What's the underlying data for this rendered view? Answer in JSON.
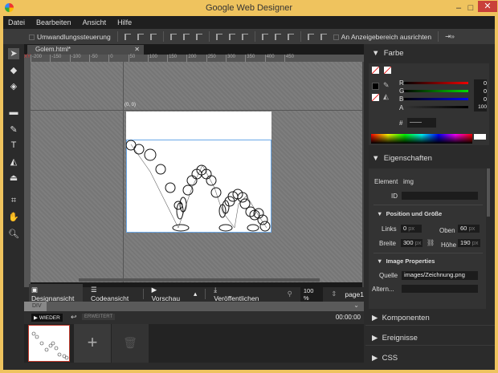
{
  "window": {
    "title": "Google Web Designer"
  },
  "menu": [
    "Datei",
    "Bearbeiten",
    "Ansicht",
    "Hilfe"
  ],
  "toolbar": {
    "transform_control": "Umwandlungssteuerung",
    "align_to_stage": "An Anzeigebereich ausrichten"
  },
  "document": {
    "tab": "Golem.html*",
    "origin_label": "(0, 0)",
    "ruler_ticks": [
      "-200",
      "-150",
      "-100",
      "-50",
      "0",
      "50",
      "100",
      "150",
      "200",
      "250",
      "300",
      "350",
      "400",
      "450"
    ]
  },
  "bottom": {
    "design_view": "Designansicht",
    "code_view": "Codeansicht",
    "preview": "Vorschau",
    "publish": "Veröffentlichen",
    "zoom": "100 %",
    "page": "page1",
    "breadcrumb": "DIV",
    "replay": "WIEDER",
    "advanced": "ERWEITERT",
    "time": "00:00:00"
  },
  "color_panel": {
    "title": "Farbe",
    "r": "0",
    "g": "0",
    "b": "0",
    "a": "100",
    "hex": "——",
    "labels": {
      "r": "R",
      "g": "G",
      "b": "B",
      "a": "A",
      "hash": "#"
    }
  },
  "properties": {
    "title": "Eigenschaften",
    "element_label": "Element",
    "element_value": "img",
    "id_label": "ID",
    "id_value": "",
    "position_title": "Position und Größe",
    "links_label": "Links",
    "links": "0",
    "oben_label": "Oben",
    "oben": "60",
    "breite_label": "Breite",
    "breite": "300",
    "hoehe_label": "Höhe",
    "hoehe": "190",
    "unit": "px",
    "image_title": "Image Properties",
    "quelle_label": "Quelle",
    "quelle": "images/Zeichnung.png",
    "alt_label": "Altern...",
    "alt": ""
  },
  "sections": [
    "Komponenten",
    "Ereignisse",
    "CSS"
  ]
}
